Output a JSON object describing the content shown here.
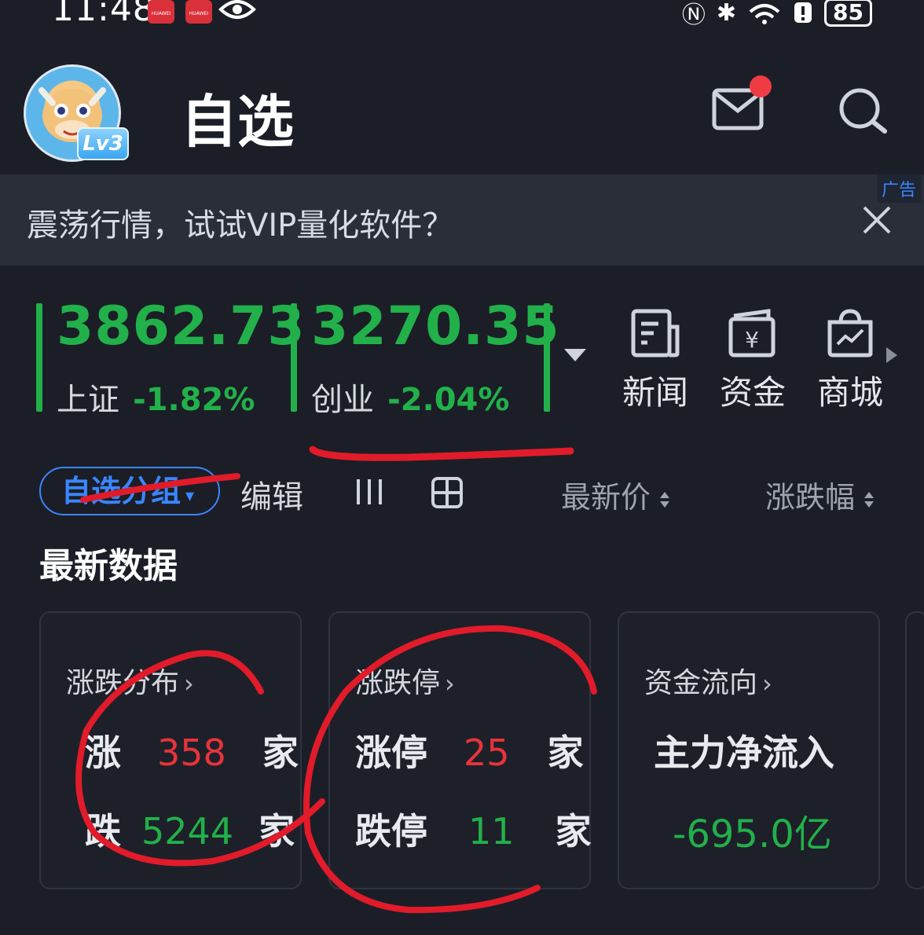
{
  "status_bar": {
    "time": "11:48",
    "app_badge_label": "HUAWEI",
    "battery": "85"
  },
  "header": {
    "title": "自选",
    "level_badge": "Lv3"
  },
  "ad": {
    "text": "震荡行情，试试VIP量化软件？",
    "tag": "广告"
  },
  "indices": [
    {
      "name": "上证",
      "value": "3862.73",
      "change": "-1.82%"
    },
    {
      "name": "创业",
      "value": "3270.35",
      "change": "-2.04%"
    }
  ],
  "quick_links": [
    {
      "label": "新闻",
      "icon": "news-icon"
    },
    {
      "label": "资金",
      "icon": "yen-wallet-icon"
    },
    {
      "label": "商城",
      "icon": "shopping-bag-icon"
    }
  ],
  "toolbar": {
    "group_label": "自选分组",
    "edit_label": "编辑",
    "sort_price_label": "最新价",
    "sort_change_label": "涨跌幅"
  },
  "section": {
    "title": "最新数据"
  },
  "cards": {
    "distribution": {
      "title": "涨跌分布",
      "up_label": "涨",
      "up_count": "358",
      "down_label": "跌",
      "down_count": "5244",
      "unit": "家"
    },
    "limit": {
      "title": "涨跌停",
      "up_label": "涨停",
      "up_count": "25",
      "down_label": "跌停",
      "down_count": "11",
      "unit": "家"
    },
    "flow": {
      "title": "资金流向",
      "label": "主力净流入",
      "value": "-695.0亿"
    }
  },
  "colors": {
    "background": "#1b1e27",
    "up_red": "#e8333b",
    "down_green": "#22b04a",
    "accent_blue": "#3a86ff",
    "annotation_red": "#e11b2a"
  }
}
